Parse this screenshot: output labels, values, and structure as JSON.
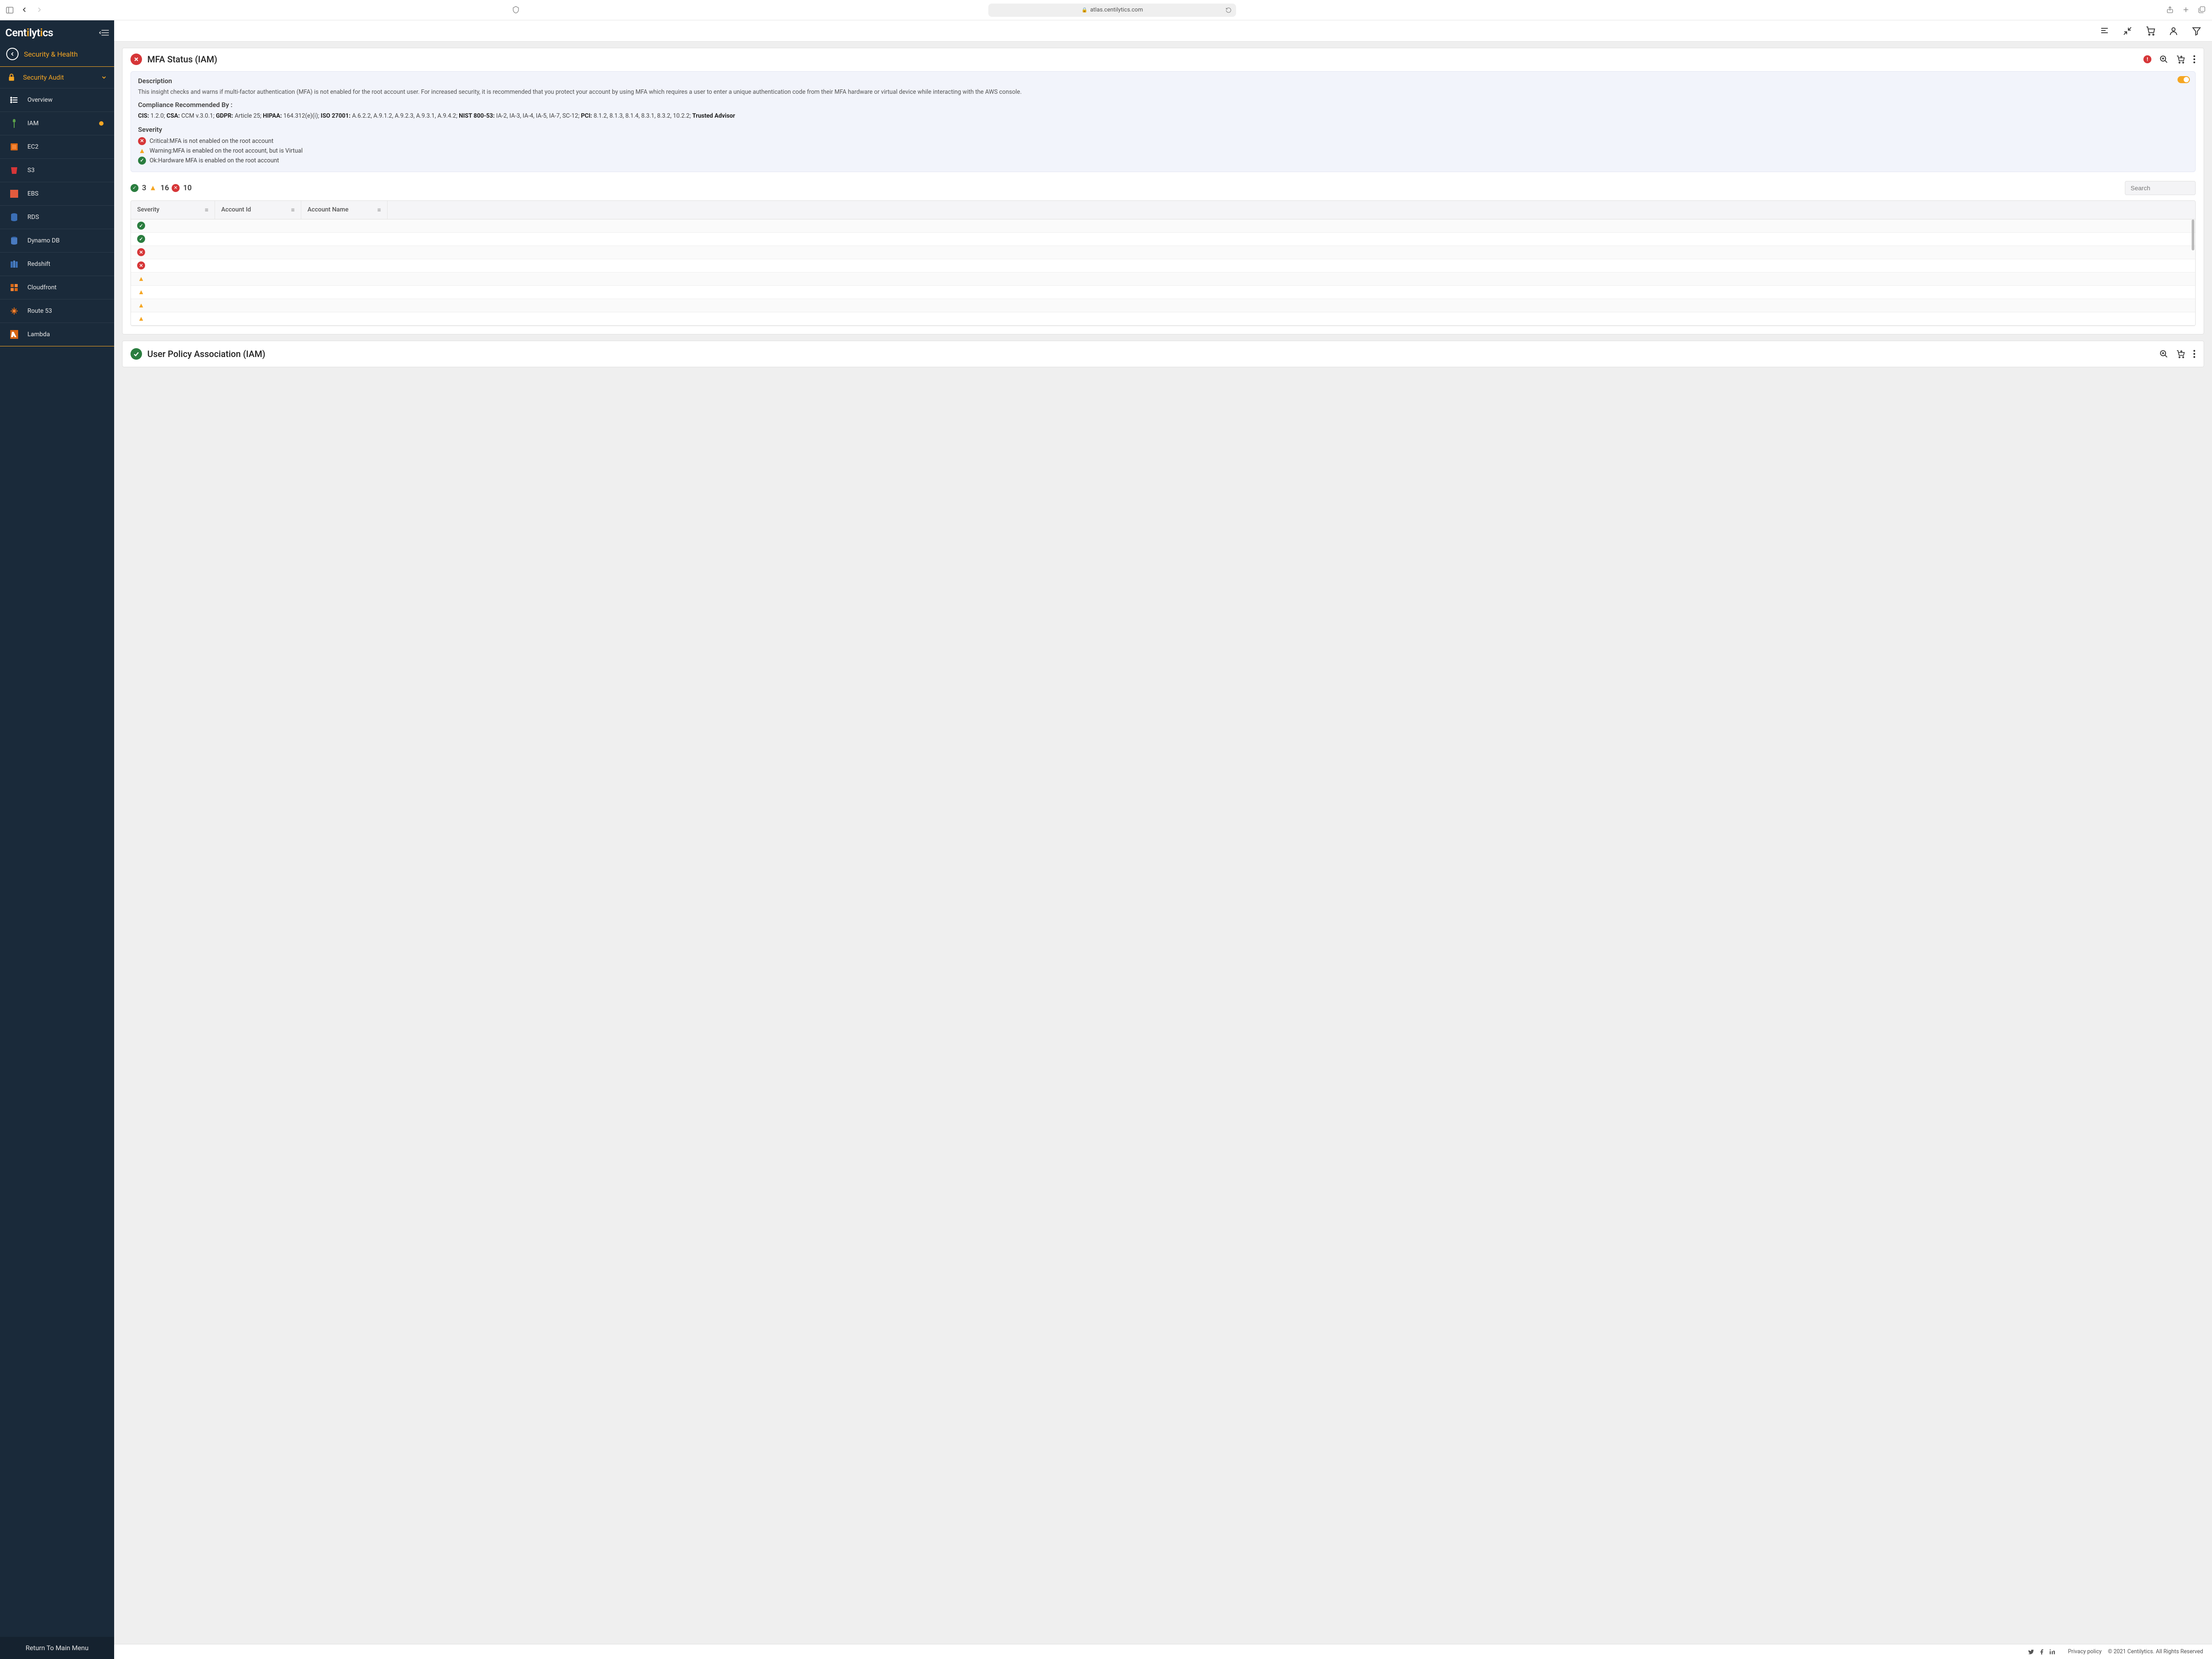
{
  "browser": {
    "url": "atlas.centilytics.com"
  },
  "brand": "Centilytics",
  "section_title": "Security & Health",
  "sidebar": {
    "group_label": "Security Audit",
    "items": [
      {
        "label": "Overview"
      },
      {
        "label": "IAM"
      },
      {
        "label": "EC2"
      },
      {
        "label": "S3"
      },
      {
        "label": "EBS"
      },
      {
        "label": "RDS"
      },
      {
        "label": "Dynamo DB"
      },
      {
        "label": "Redshift"
      },
      {
        "label": "Cloudfront"
      },
      {
        "label": "Route 53"
      },
      {
        "label": "Lambda"
      }
    ],
    "footer": "Return To Main Menu"
  },
  "cards": {
    "mfa": {
      "title": "MFA Status (IAM)",
      "desc_h": "Description",
      "desc": "This insight checks and warns if multi-factor authentication (MFA) is not enabled for the root account user. For increased security, it is recommended that you protect your account by using MFA which requires a user to enter a unique authentication code from their MFA hardware or virtual device while interacting with the AWS console.",
      "compl_h": "Compliance Recommended By :",
      "compl": {
        "CIS": "1.2.0;",
        "CSA": "CCM v.3.0.1;",
        "GDPR": "Article 25;",
        "HIPAA": "164.312(e)(i);",
        "ISO 27001": "A.6.2.2, A.9.1.2, A.9.2.3, A.9.3.1, A.9.4.2;",
        "NIST 800-53": "IA-2, IA-3, IA-4, IA-5, IA-7, SC-12;",
        "PCI": "8.1.2, 8.1.3, 8.1.4, 8.3.1, 8.3.2, 10.2.2;",
        "Trusted Advisor": ""
      },
      "sev_h": "Severity",
      "sev_rows": [
        {
          "level": "crit",
          "text": "Critical:MFA is not enabled on the root account"
        },
        {
          "level": "warn",
          "text": "Warning:MFA is enabled on the root account, but is Virtual"
        },
        {
          "level": "ok",
          "text": "Ok:Hardware MFA is enabled on the root account"
        }
      ],
      "counts": {
        "ok": "3",
        "warn": "16",
        "crit": "10"
      },
      "search_placeholder": "Search",
      "columns": [
        "Severity",
        "Account Id",
        "Account Name"
      ],
      "rows": [
        {
          "sev": "ok"
        },
        {
          "sev": "ok"
        },
        {
          "sev": "crit"
        },
        {
          "sev": "crit"
        },
        {
          "sev": "warn"
        },
        {
          "sev": "warn"
        },
        {
          "sev": "warn"
        },
        {
          "sev": "warn"
        }
      ]
    },
    "upa": {
      "title": "User Policy Association (IAM)"
    }
  },
  "footer": {
    "privacy": "Privacy policy",
    "copyright": "© 2021 Centilytics. All Rights Reserved"
  }
}
